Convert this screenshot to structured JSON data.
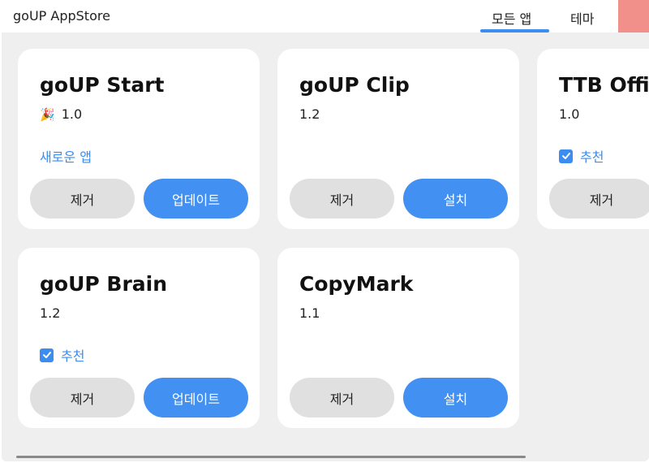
{
  "window": {
    "title": "goUP AppStore"
  },
  "tabs": [
    {
      "label": "모든 앱",
      "active": true
    },
    {
      "label": "테마",
      "active": false
    }
  ],
  "colors": {
    "accent": "#3b8df0",
    "primary_button": "#4290f2",
    "remove_button": "#e0e0e0",
    "background": "#efefef",
    "window_accent": "#f1908a"
  },
  "apps": [
    {
      "name": "goUP Start",
      "version": "1.0",
      "badge_icon": "party-popper-icon",
      "tag": "새로운 앱",
      "tag_checked": false,
      "remove_label": "제거",
      "action_label": "업데이트"
    },
    {
      "name": "goUP Clip",
      "version": "1.2",
      "tag": "",
      "remove_label": "제거",
      "action_label": "설치"
    },
    {
      "name": "TTB Office",
      "version": "1.0",
      "tag": "추천",
      "tag_checked": true,
      "remove_label": "제거",
      "action_label": ""
    },
    {
      "name": "goUP Brain",
      "version": "1.2",
      "tag": "추천",
      "tag_checked": true,
      "remove_label": "제거",
      "action_label": "업데이트"
    },
    {
      "name": "CopyMark",
      "version": "1.1",
      "tag": "",
      "remove_label": "제거",
      "action_label": "설치"
    }
  ]
}
